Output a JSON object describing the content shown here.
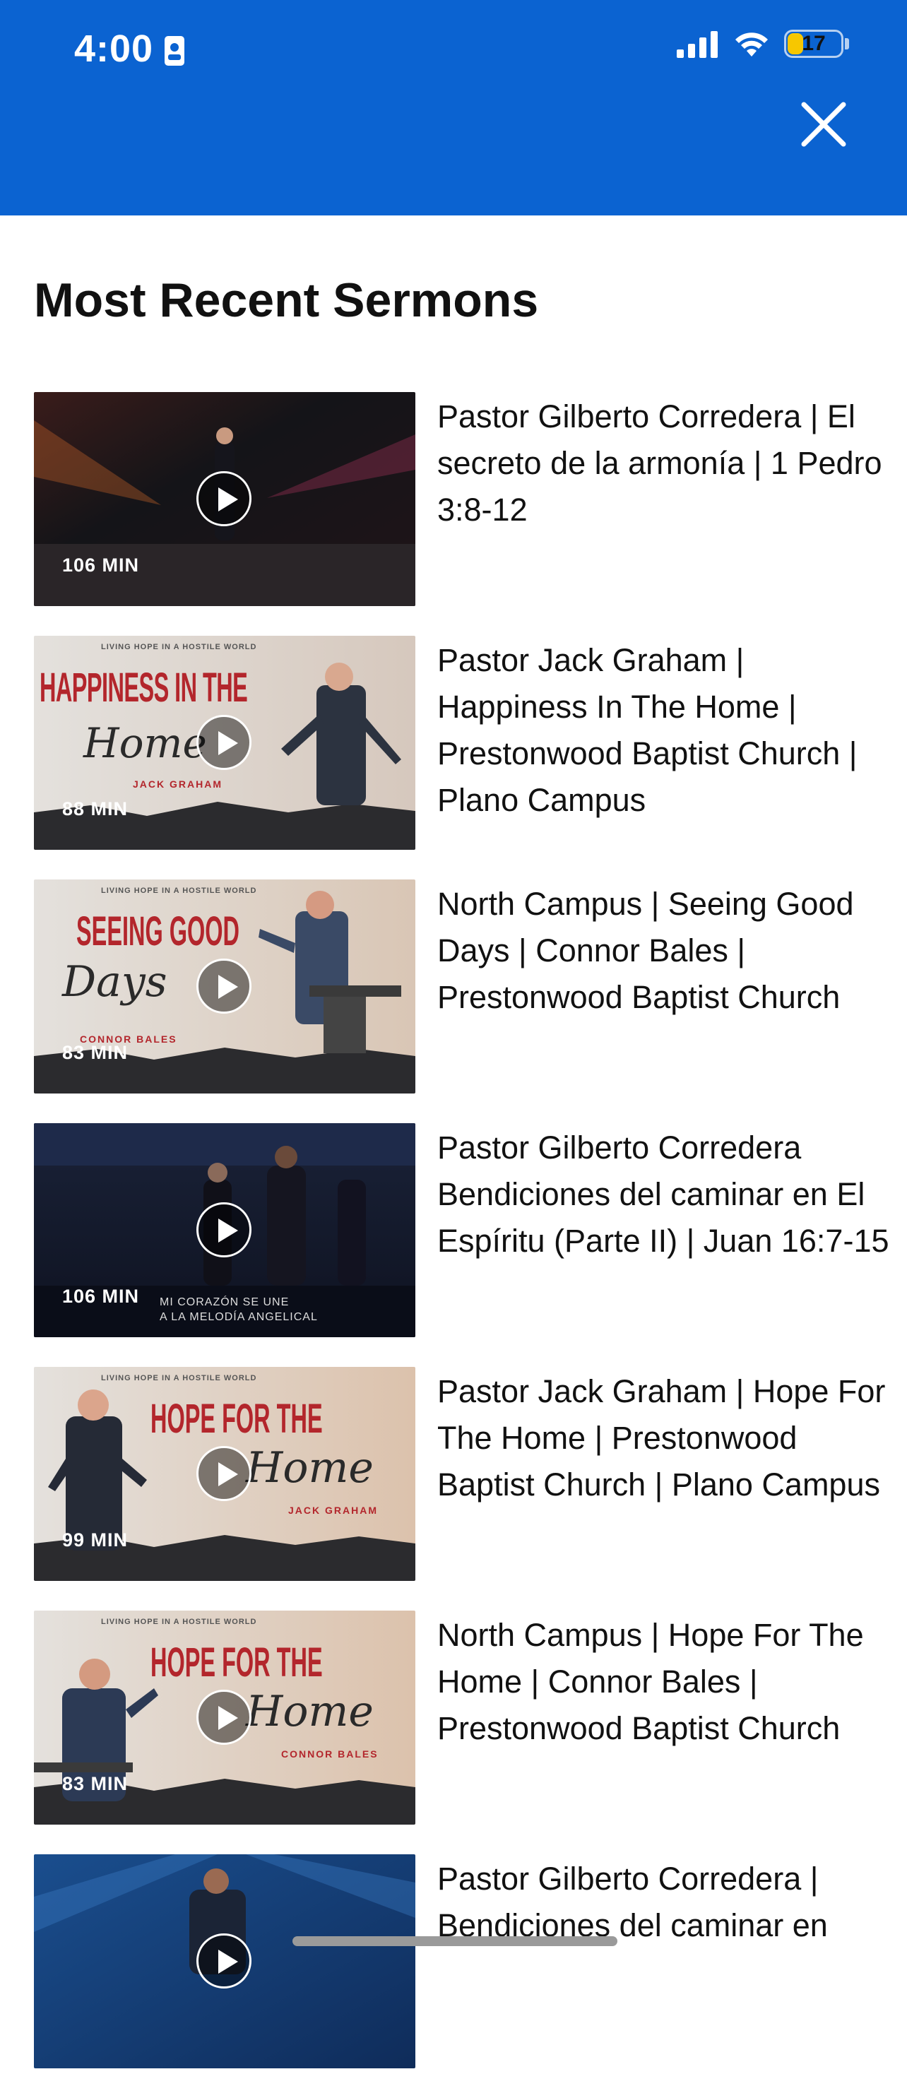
{
  "status_bar": {
    "time": "4:00",
    "battery": "17"
  },
  "header": {
    "close_icon": "close-icon"
  },
  "page": {
    "title": "Most Recent Sermons"
  },
  "sermons": [
    {
      "title": "Pastor Gilberto Corredera | El secreto de la armonía | 1 Pedro 3:8-12",
      "duration": "106 MIN"
    },
    {
      "title": "Pastor Jack Graham | Happiness In The Home | Prestonwood Baptist Church | Plano Campus",
      "duration": "88 MIN",
      "thumb_text": {
        "top": "LIVING HOPE IN A HOSTILE WORLD",
        "main": "HAPPINESS IN THE",
        "script": "Home",
        "author": "JACK GRAHAM"
      }
    },
    {
      "title": "North Campus | Seeing Good Days | Connor Bales | Prestonwood Baptist Church",
      "duration": "83 MIN",
      "thumb_text": {
        "top": "LIVING HOPE IN A HOSTILE WORLD",
        "main": "SEEING GOOD",
        "script": "Days",
        "author": "CONNOR BALES"
      }
    },
    {
      "title": "Pastor Gilberto Corredera Bendiciones del caminar en El Espíritu (Parte II) | Juan 16:7-15",
      "duration": "106 MIN",
      "thumb_text": {
        "line1": "MI CORAZÓN SE UNE",
        "line2": "A LA MELODÍA ANGELICAL"
      }
    },
    {
      "title": "Pastor Jack Graham | Hope For The Home | Prestonwood Baptist Church | Plano Campus",
      "duration": "99 MIN",
      "thumb_text": {
        "top": "LIVING HOPE IN A HOSTILE WORLD",
        "main": "HOPE FOR THE",
        "script": "Home",
        "author": "JACK GRAHAM"
      }
    },
    {
      "title": "North Campus | Hope For The Home | Connor Bales | Prestonwood Baptist Church",
      "duration": "83 MIN",
      "thumb_text": {
        "top": "LIVING HOPE IN A HOSTILE WORLD",
        "main": "HOPE FOR THE",
        "script": "Home",
        "author": "CONNOR BALES"
      }
    },
    {
      "title": "Pastor Gilberto Corredera | Bendiciones del caminar en",
      "duration": ""
    }
  ],
  "colors": {
    "header_bg": "#0B63D1",
    "accent_red": "#B3262C",
    "battery": "#F7C700"
  }
}
